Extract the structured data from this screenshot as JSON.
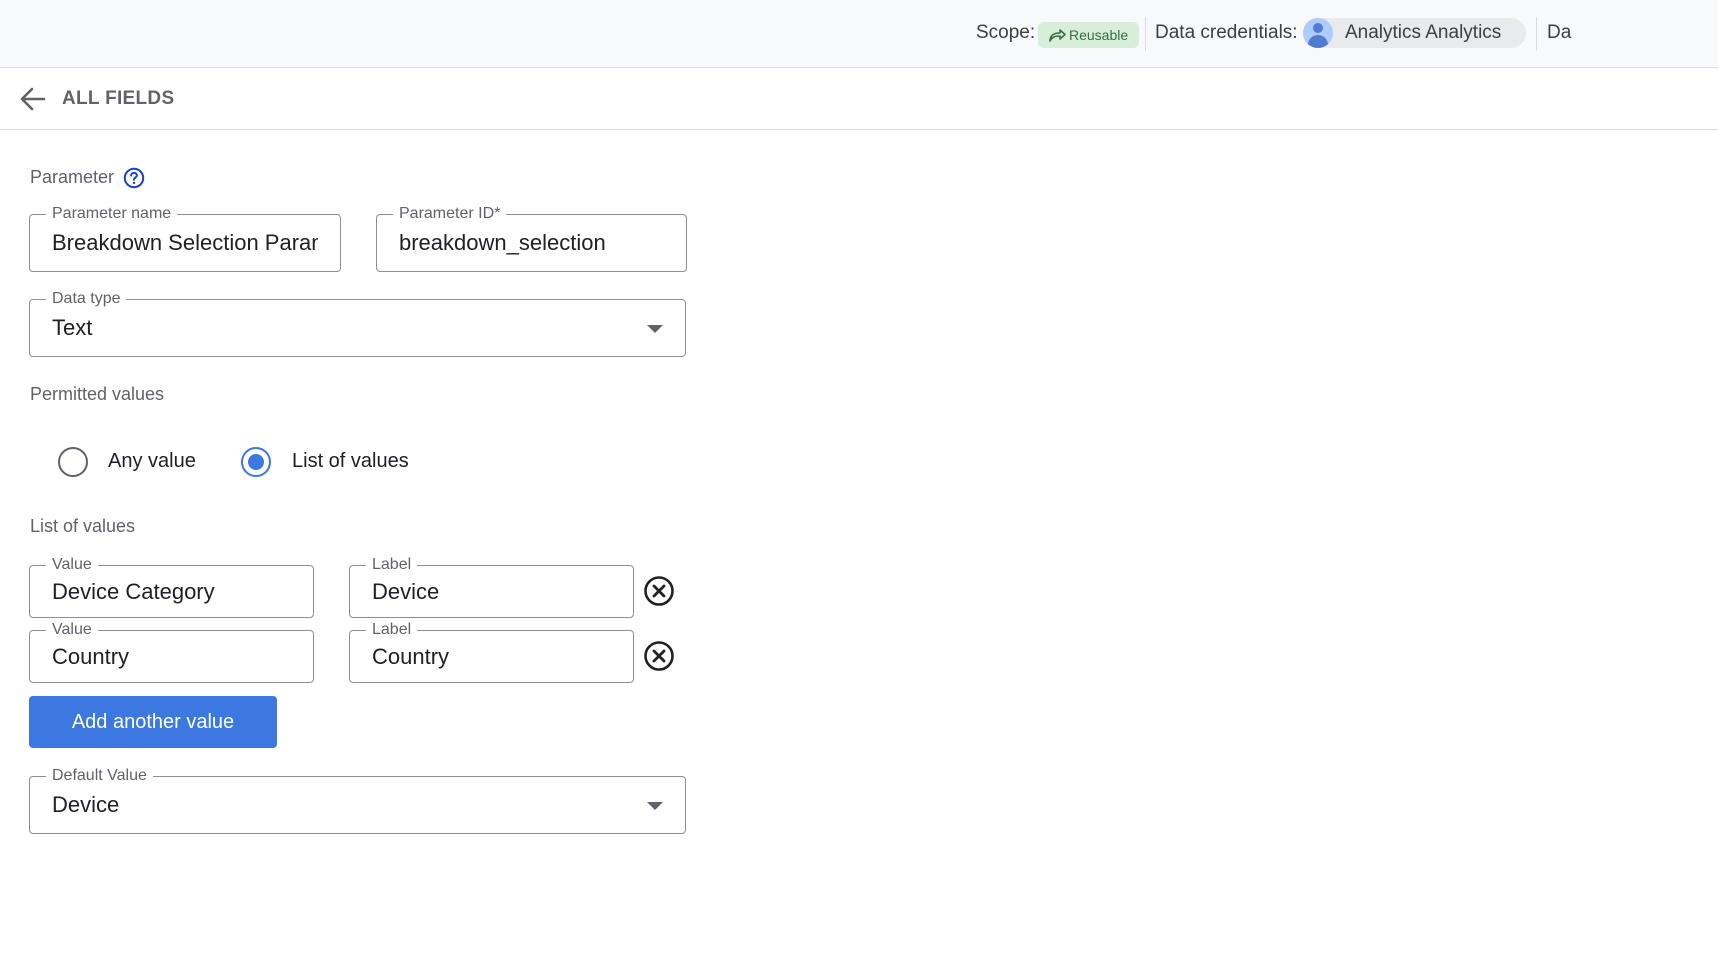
{
  "topbar": {
    "scope_label": "Scope:",
    "scope_chip": "Reusable",
    "credentials_label": "Data credentials:",
    "credentials_name": "Analytics Analytics",
    "cut_text": "Da"
  },
  "header": {
    "title": "ALL FIELDS"
  },
  "parameter": {
    "section_title": "Parameter",
    "name_label": "Parameter name",
    "name_value": "Breakdown Selection Parameter",
    "id_label": "Parameter ID*",
    "id_value": "breakdown_selection",
    "data_type_label": "Data type",
    "data_type_value": "Text"
  },
  "permitted": {
    "section_title": "Permitted values",
    "options": [
      {
        "label": "Any value",
        "checked": false
      },
      {
        "label": "List of values",
        "checked": true
      }
    ]
  },
  "list": {
    "section_title": "List of values",
    "rows": [
      {
        "value_label": "Value",
        "value": "Device Category",
        "label_label": "Label",
        "label": "Device"
      },
      {
        "value_label": "Value",
        "value": "Country",
        "label_label": "Label",
        "label": "Country"
      }
    ],
    "add_button": "Add another value"
  },
  "default_value": {
    "label": "Default Value",
    "value": "Device"
  },
  "colors": {
    "accent": "#3c78e0",
    "chip_bg": "#d7eed9",
    "chip_text": "#3c6b46"
  }
}
